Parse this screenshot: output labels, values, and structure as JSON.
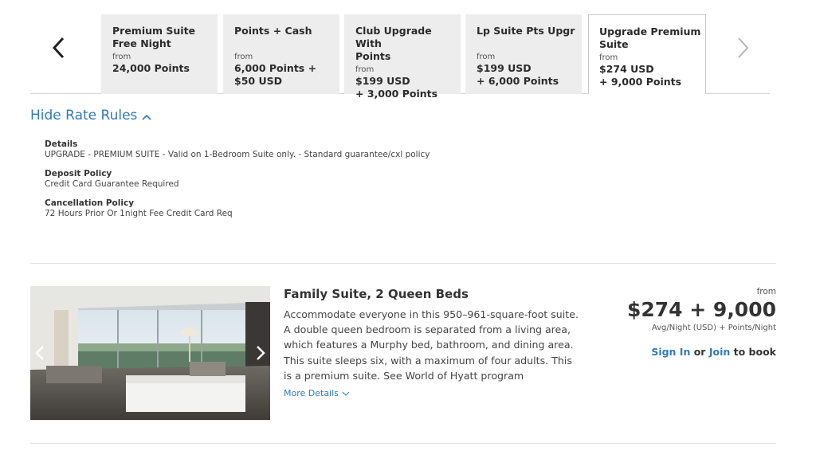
{
  "rate_tabs": [
    {
      "title": "Premium Suite Free Night",
      "from": "from",
      "price": "24,000 Points",
      "active": false
    },
    {
      "title": "Points + Cash",
      "from": "from",
      "price": "6,000 Points + $50 USD",
      "active": false
    },
    {
      "title": "Club Upgrade With Points",
      "from": "from",
      "price": "$199 USD + 3,000 Points",
      "active": false
    },
    {
      "title": "Lp Suite Pts Upgr",
      "from": "from",
      "price": "$199 USD + 6,000 Points",
      "active": false
    },
    {
      "title": "Upgrade Premium Suite",
      "from": "from",
      "price": "$274 USD + 9,000 Points",
      "active": true
    }
  ],
  "rate_tab_lines": [
    {
      "title": [
        "Premium Suite",
        "Free Night"
      ],
      "price": [
        "24,000 Points"
      ]
    },
    {
      "title": [
        "Points + Cash"
      ],
      "price": [
        "6,000 Points +",
        "$50 USD"
      ]
    },
    {
      "title": [
        "Club Upgrade With",
        "Points"
      ],
      "price": [
        "$199 USD",
        "+ 3,000 Points"
      ]
    },
    {
      "title": [
        "Lp Suite Pts Upgr"
      ],
      "price": [
        "$199 USD",
        "+ 6,000 Points"
      ]
    },
    {
      "title": [
        "Upgrade Premium",
        "Suite"
      ],
      "price": [
        "$274 USD",
        "+ 9,000 Points"
      ]
    }
  ],
  "hide_rules_label": "Hide Rate Rules",
  "rules": {
    "details": {
      "heading": "Details",
      "text": "UPGRADE - PREMIUM SUITE - Valid on 1-Bedroom Suite only. - Standard guarantee/cxl policy"
    },
    "deposit": {
      "heading": "Deposit Policy",
      "text": "Credit Card Guarantee Required"
    },
    "cancellation": {
      "heading": "Cancellation Policy",
      "text": "72 Hours Prior Or 1night Fee Credit Card Req"
    }
  },
  "room": {
    "title": "Family Suite, 2 Queen Beds",
    "description": "Accommodate everyone in this 950–961-square-foot suite. A double queen bedroom is separated from a living area, which features a Murphy bed, bathroom, and dining area. This suite sleeps six, with a maximum of four adults. This is a premium suite. See World of Hyatt program",
    "more_details": "More Details",
    "price_from": "from",
    "price": "$274 + 9,000",
    "price_unit": "Avg/Night (USD) + Points/Night",
    "sign_in": "Sign In",
    "or": "or",
    "join": "Join",
    "to_book": "to book"
  },
  "colors": {
    "accent": "#2f7ab9",
    "tab_bg": "#ededed"
  }
}
